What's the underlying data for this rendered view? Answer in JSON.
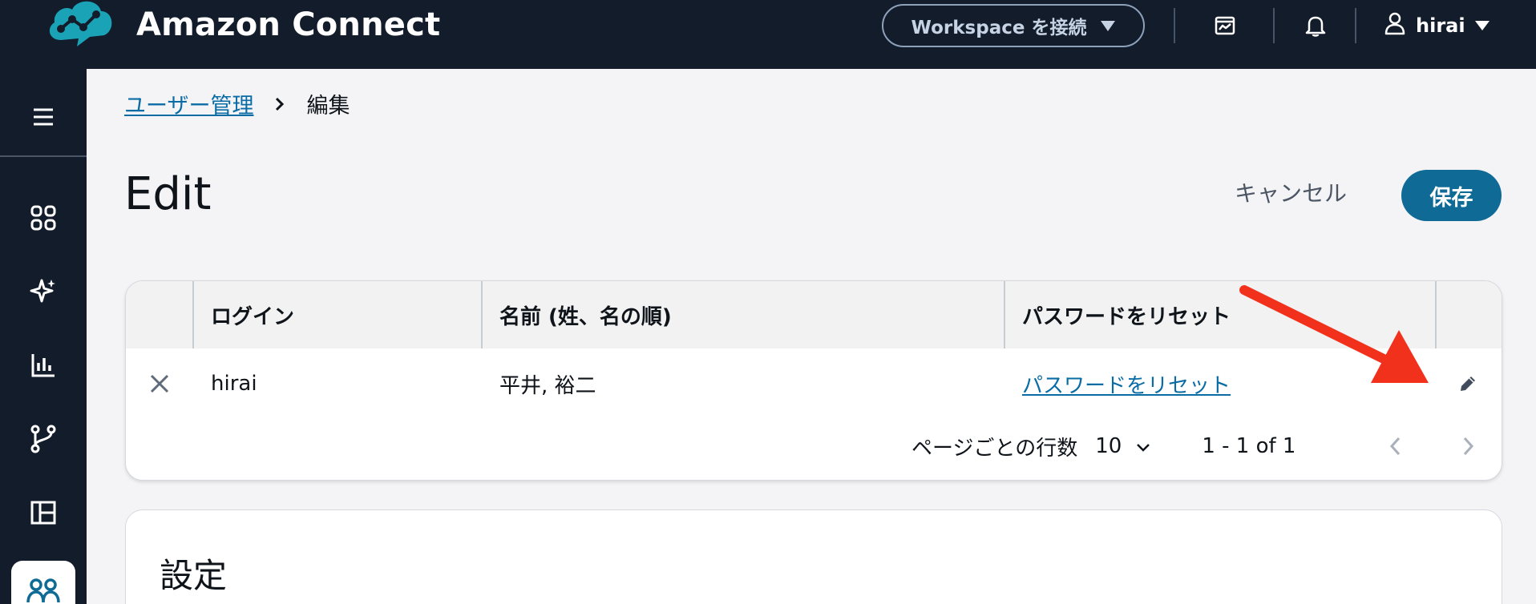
{
  "topbar": {
    "app_title": "Amazon Connect",
    "workspace_button": "Workspace を接続",
    "user_name": "hirai",
    "icons": [
      "amazon-connect-logo-icon",
      "chart-icon",
      "bell-icon",
      "user-icon",
      "caret-down-icon"
    ]
  },
  "nav": {
    "icons": [
      "hamburger-menu-icon",
      "dashboard-grid-icon",
      "sparkle-icon",
      "analytics-bar-icon",
      "routing-flow-icon",
      "layout-panel-icon",
      "users-icon"
    ]
  },
  "breadcrumb": {
    "parent": "ユーザー管理",
    "current": "編集"
  },
  "header": {
    "title": "Edit",
    "cancel_label": "キャンセル",
    "save_label": "保存"
  },
  "table": {
    "columns": [
      "ログイン",
      "名前 (姓、名の順)",
      "パスワードをリセット",
      ""
    ],
    "rows": [
      {
        "login": "hirai",
        "name": "平井, 裕二",
        "reset": "パスワードをリセット"
      }
    ],
    "pagination": {
      "rows_per_page_label": "ページごとの行数",
      "rows_per_page_value": "10",
      "range": "1 - 1 of 1"
    }
  },
  "settings": {
    "title": "設定"
  },
  "colors": {
    "topbar_bg": "#131c2b",
    "accent_blue": "#0f6b96",
    "link_blue": "#0a6ca5",
    "logo_teal": "#1aa3b6",
    "annotation_red": "#f2311d"
  }
}
